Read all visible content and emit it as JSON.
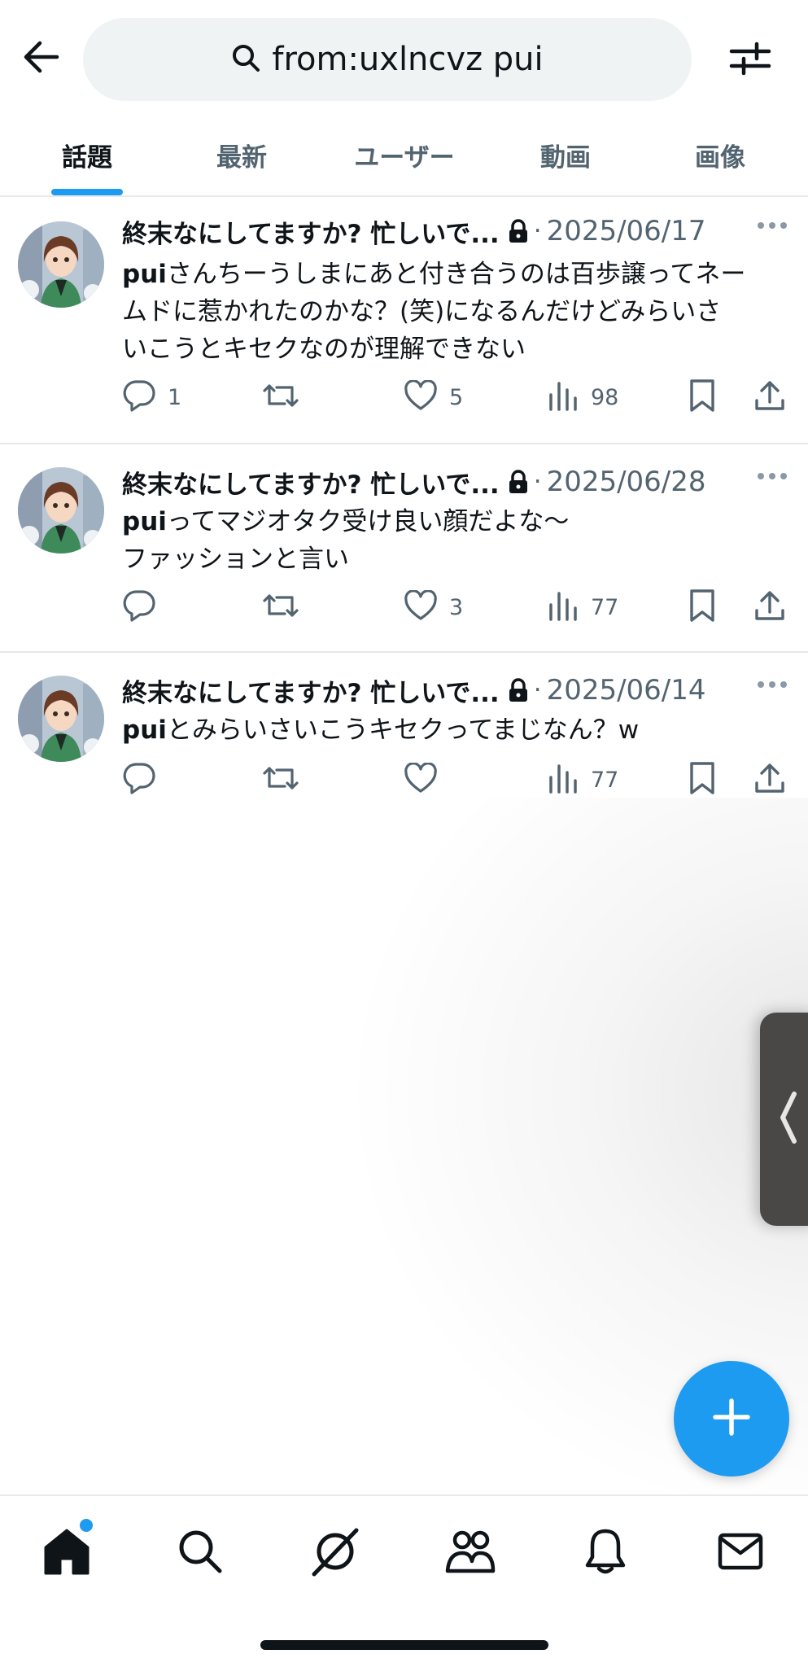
{
  "search": {
    "query": "from:uxlncvz pui"
  },
  "tabs": [
    {
      "label": "話題",
      "active": true
    },
    {
      "label": "最新",
      "active": false
    },
    {
      "label": "ユーザー",
      "active": false
    },
    {
      "label": "動画",
      "active": false
    },
    {
      "label": "画像",
      "active": false
    }
  ],
  "tweets": [
    {
      "name": "終末なにしてますか? 忙しいで...",
      "date": "2025/06/17",
      "highlight": "pui",
      "text_line1_rest": "さんちーうしまにあと付き合うのは百歩譲ってネー",
      "text_line2": "ムドに惹かれたのかな？(笑)になるんだけどみらいさ",
      "text_line3": "いこうとキセクなのが理解できない",
      "replies": "1",
      "retweets": "",
      "likes": "5",
      "views": "98"
    },
    {
      "name": "終末なにしてますか? 忙しいで...",
      "date": "2025/06/28",
      "highlight": "pui",
      "text_line1_rest": "ってマジオタク受け良い顔だよな〜",
      "text_line2": "ファッションと言い",
      "replies": "",
      "retweets": "",
      "likes": "3",
      "views": "77"
    },
    {
      "name": "終末なにしてますか? 忙しいで...",
      "date": "2025/06/14",
      "highlight": "pui",
      "text_line1_rest": "とみらいさいこうキセクってまじなん？w",
      "replies": "",
      "retweets": "",
      "likes": "",
      "views": "77"
    }
  ],
  "colors": {
    "accent": "#1d9bf0",
    "text_primary": "#0f1419",
    "text_secondary": "#536471",
    "divider": "#e7eaec",
    "search_bg": "#eff3f4"
  },
  "icons": {
    "back": "arrow-left-icon",
    "search": "magnifier-icon",
    "filter": "sliders-icon",
    "lock": "lock-icon",
    "more": "more-dots-icon",
    "reply": "reply-icon",
    "retweet": "retweet-icon",
    "like": "heart-icon",
    "views": "bar-chart-icon",
    "bookmark": "bookmark-icon",
    "share": "share-icon",
    "compose": "plus-icon",
    "nav_home": "home-icon",
    "nav_search": "search-icon",
    "nav_grok": "grok-icon",
    "nav_communities": "communities-icon",
    "nav_notifications": "bell-icon",
    "nav_messages": "mail-icon"
  }
}
